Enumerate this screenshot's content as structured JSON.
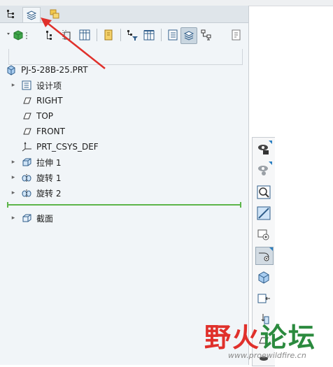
{
  "model_tree": {
    "root_label": "PJ-5-28B-25.PRT",
    "items": [
      {
        "label": "设计项",
        "expandable": true,
        "icon": "design-items-icon"
      },
      {
        "label": "RIGHT",
        "expandable": false,
        "icon": "datum-plane-icon"
      },
      {
        "label": "TOP",
        "expandable": false,
        "icon": "datum-plane-icon"
      },
      {
        "label": "FRONT",
        "expandable": false,
        "icon": "datum-plane-icon"
      },
      {
        "label": "PRT_CSYS_DEF",
        "expandable": false,
        "icon": "csys-icon"
      },
      {
        "label": "拉伸 1",
        "expandable": true,
        "icon": "extrude-icon"
      },
      {
        "label": "旋转 1",
        "expandable": true,
        "icon": "revolve-icon"
      },
      {
        "label": "旋转 2",
        "expandable": true,
        "icon": "revolve-icon"
      }
    ],
    "after_insert": [
      {
        "label": "截面",
        "expandable": true,
        "icon": "section-icon"
      }
    ]
  },
  "watermark": {
    "part1": "野火",
    "part2": "论坛",
    "url": "www.proewildfire.cn"
  },
  "colors": {
    "insert_line": "#5db54a",
    "arrow": "#e0302b",
    "watermark_red": "#e0302b",
    "watermark_green": "#2b8a3e"
  }
}
